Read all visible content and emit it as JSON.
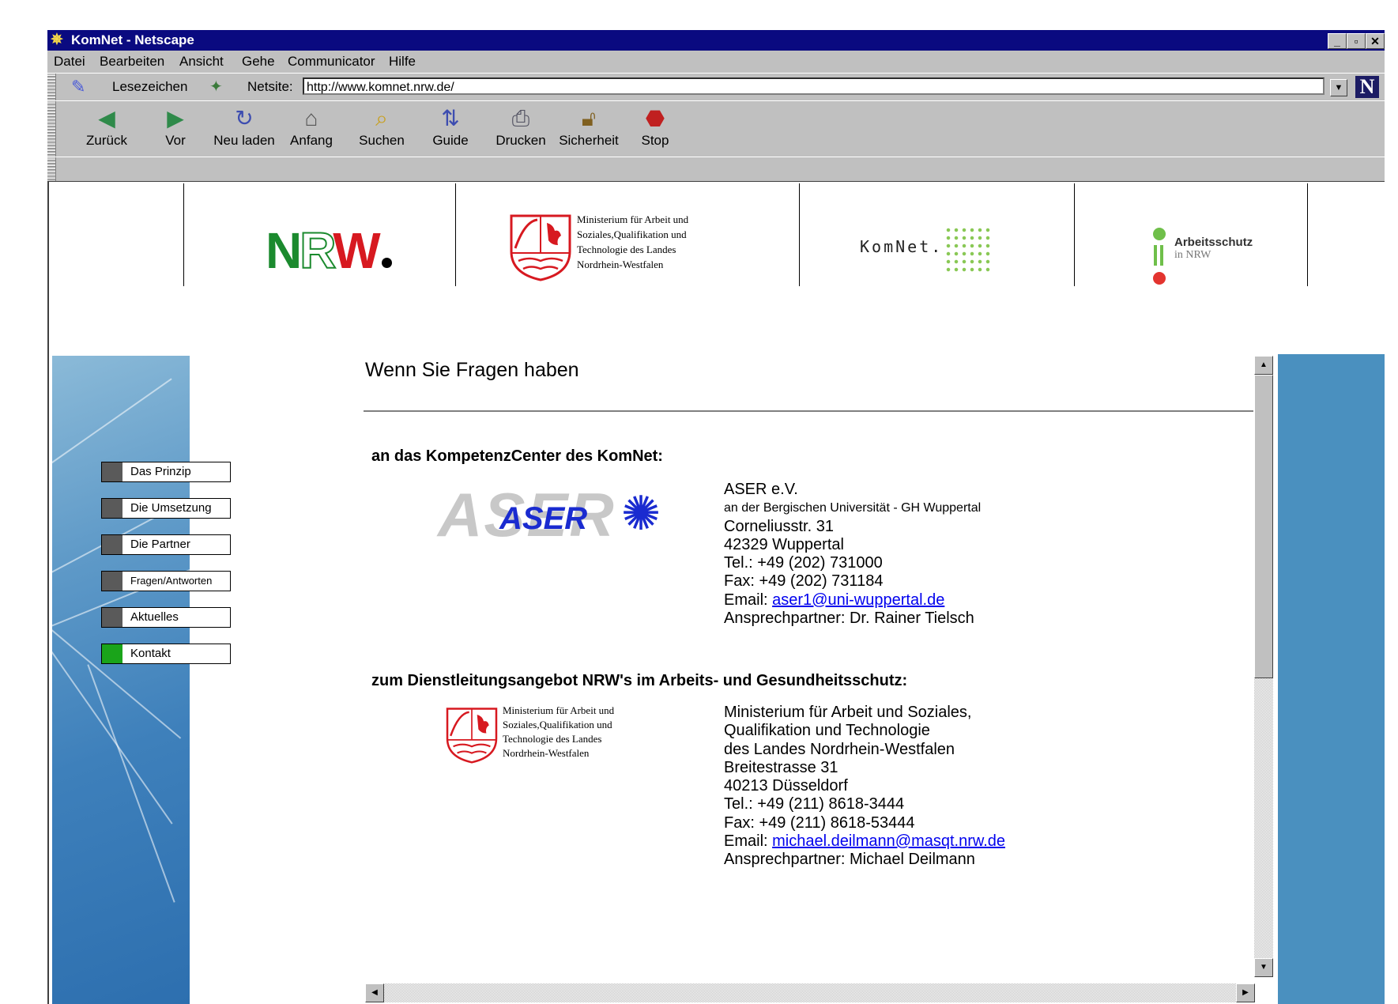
{
  "window": {
    "title": "KomNet - Netscape",
    "buttons": [
      "_",
      "▫",
      "✕"
    ]
  },
  "menubar": {
    "items": [
      "Datei",
      "Bearbeiten",
      "Ansicht",
      "Gehe",
      "Communicator",
      "Hilfe"
    ]
  },
  "location": {
    "bookmarks_label": "Lesezeichen",
    "netsite_label": "Netsite:",
    "url": "http://www.komnet.nrw.de/"
  },
  "navigation": {
    "buttons": [
      {
        "label": "Zurück",
        "icon": "back-arrow-icon"
      },
      {
        "label": "Vor",
        "icon": "forward-arrow-icon"
      },
      {
        "label": "Neu laden",
        "icon": "reload-icon"
      },
      {
        "label": "Anfang",
        "icon": "home-icon"
      },
      {
        "label": "Suchen",
        "icon": "search-icon"
      },
      {
        "label": "Guide",
        "icon": "guide-icon"
      },
      {
        "label": "Drucken",
        "icon": "print-icon"
      },
      {
        "label": "Sicherheit",
        "icon": "security-lock-icon"
      },
      {
        "label": "Stop",
        "icon": "stop-icon"
      }
    ]
  },
  "header": {
    "nrw_logo": {
      "n": "N",
      "r": "R",
      "w": "W"
    },
    "ministry": {
      "lines": [
        "Ministerium für Arbeit und",
        "Soziales,Qualifikation und",
        "Technologie des Landes",
        "Nordrhein-Westfalen"
      ]
    },
    "komnet_logo": "KomNet.",
    "arbeitsschutz": {
      "title": "Arbeitsschutz",
      "subtitle": "in NRW"
    }
  },
  "sidebar": {
    "items": [
      {
        "label": "Das Prinzip",
        "active": false
      },
      {
        "label": "Die Umsetzung",
        "active": false
      },
      {
        "label": "Die Partner",
        "active": false
      },
      {
        "label": "Fragen/Antworten",
        "active": false
      },
      {
        "label": "Aktuelles",
        "active": false
      },
      {
        "label": "Kontakt",
        "active": true
      }
    ]
  },
  "main": {
    "heading": "Wenn Sie Fragen haben",
    "section1": {
      "title": "an das KompetenzCenter des KomNet:",
      "logo_big": "ASER",
      "logo_small": "ASER",
      "org": "ASER e.V.",
      "org_sub": "an der Bergischen Universität - GH Wuppertal",
      "street": "Corneliusstr. 31",
      "city": "42329 Wuppertal",
      "tel": "Tel.: +49 (202) 731000",
      "fax": "Fax: +49 (202) 731184",
      "email_label": "Email: ",
      "email": "aser1@uni-wuppertal.de",
      "contact": "Ansprechpartner: Dr. Rainer Tielsch"
    },
    "section2": {
      "title": "zum Dienstleitungsangebot NRW's im Arbeits- und Gesundheitsschutz:",
      "logo_lines": [
        "Ministerium für Arbeit und",
        "Soziales,Qualifikation und",
        "Technologie des Landes",
        "Nordrhein-Westfalen"
      ],
      "org1": "Ministerium für Arbeit und Soziales,",
      "org2": "Qualifikation und Technologie",
      "org3": "des Landes Nordrhein-Westfalen",
      "street": "Breitestrasse 31",
      "city": "40213 Düsseldorf",
      "tel": "Tel.: +49 (211) 8618-3444",
      "fax": "Fax: +49 (211) 8618-53444",
      "email_label": "Email: ",
      "email": "michael.deilmann@masqt.nrw.de",
      "contact": "Ansprechpartner: Michael Deilmann"
    }
  },
  "colors": {
    "titlebar": "#0a0a80",
    "chrome": "#c0c0c0",
    "nrw_green": "#1b8a2e",
    "nrw_red": "#d71920",
    "sidebar_blue": "#4a90bf",
    "active_marker": "#1aa41a",
    "link": "#0000ee"
  }
}
